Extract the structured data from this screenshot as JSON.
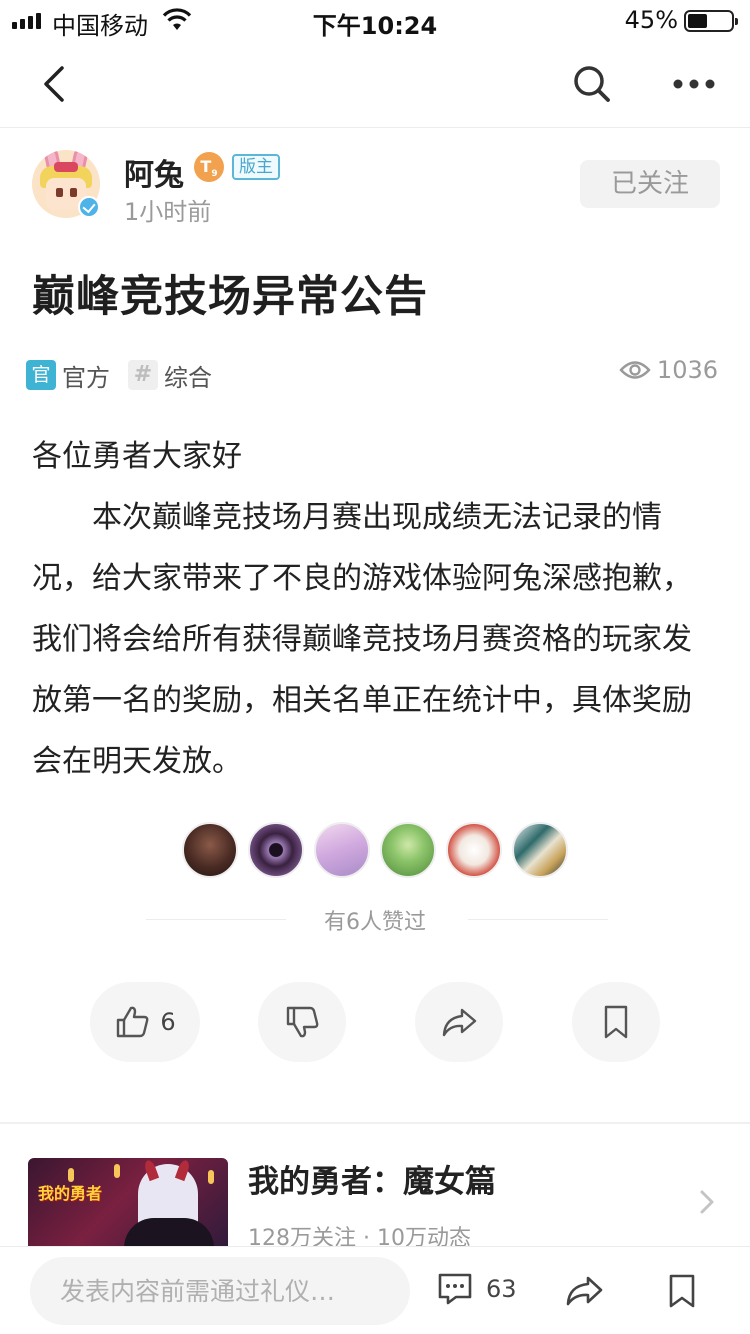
{
  "status_bar": {
    "carrier": "中国移动",
    "time": "下午10:24",
    "battery": "45%",
    "battery_level": 0.45
  },
  "nav": {
    "icons": [
      "back-arrow-icon",
      "search-icon",
      "more-icon"
    ]
  },
  "author": {
    "name": "阿兔",
    "level": "T",
    "level_sub": "9",
    "role": "版主",
    "time": "1小时前",
    "follow_label": "已关注"
  },
  "post": {
    "title": "巅峰竞技场异常公告",
    "tags": [
      {
        "icon": "官",
        "label": "官方"
      },
      {
        "icon": "#",
        "label": "综合"
      }
    ],
    "views": "1036",
    "greeting": "各位勇者大家好",
    "body": "本次巅峰竞技场月赛出现成绩无法记录的情况，给大家带来了不良的游戏体验阿兔深感抱歉，我们将会给所有获得巅峰竞技场月赛资格的玩家发放第一名的奖励，相关名单正在统计中，具体奖励会在明天发放。"
  },
  "likes": {
    "liked_text": "有6人赞过",
    "avatar_colors": [
      "#4a2b24",
      "#3a2140",
      "#d8b8e4",
      "#6fa65a",
      "#f2e8e0",
      "#2f6a6a"
    ]
  },
  "actions": {
    "like_count": "6",
    "icons": [
      "thumbs-up-icon",
      "thumbs-down-icon",
      "share-icon",
      "bookmark-icon"
    ]
  },
  "game": {
    "name": "我的勇者：魔女篇",
    "stats": "128万关注 · 10万动态",
    "thumb_text": "我的勇者"
  },
  "bottom": {
    "placeholder": "发表内容前需通过礼仪…",
    "comment_count": "63"
  },
  "colors": {
    "accent": "#3fb3d3",
    "muted": "#9a9a9a",
    "level_badge": "#f2a14e"
  }
}
